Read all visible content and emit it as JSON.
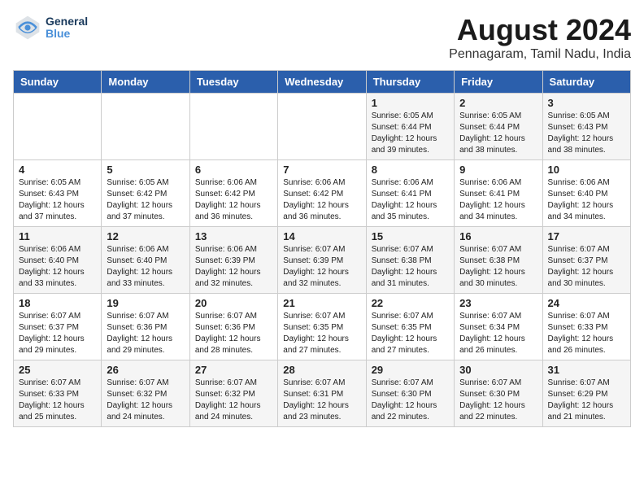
{
  "logo": {
    "line1": "General",
    "line2": "Blue"
  },
  "title": "August 2024",
  "subtitle": "Pennagaram, Tamil Nadu, India",
  "headers": [
    "Sunday",
    "Monday",
    "Tuesday",
    "Wednesday",
    "Thursday",
    "Friday",
    "Saturday"
  ],
  "weeks": [
    [
      {
        "day": "",
        "info": ""
      },
      {
        "day": "",
        "info": ""
      },
      {
        "day": "",
        "info": ""
      },
      {
        "day": "",
        "info": ""
      },
      {
        "day": "1",
        "info": "Sunrise: 6:05 AM\nSunset: 6:44 PM\nDaylight: 12 hours\nand 39 minutes."
      },
      {
        "day": "2",
        "info": "Sunrise: 6:05 AM\nSunset: 6:44 PM\nDaylight: 12 hours\nand 38 minutes."
      },
      {
        "day": "3",
        "info": "Sunrise: 6:05 AM\nSunset: 6:43 PM\nDaylight: 12 hours\nand 38 minutes."
      }
    ],
    [
      {
        "day": "4",
        "info": "Sunrise: 6:05 AM\nSunset: 6:43 PM\nDaylight: 12 hours\nand 37 minutes."
      },
      {
        "day": "5",
        "info": "Sunrise: 6:05 AM\nSunset: 6:42 PM\nDaylight: 12 hours\nand 37 minutes."
      },
      {
        "day": "6",
        "info": "Sunrise: 6:06 AM\nSunset: 6:42 PM\nDaylight: 12 hours\nand 36 minutes."
      },
      {
        "day": "7",
        "info": "Sunrise: 6:06 AM\nSunset: 6:42 PM\nDaylight: 12 hours\nand 36 minutes."
      },
      {
        "day": "8",
        "info": "Sunrise: 6:06 AM\nSunset: 6:41 PM\nDaylight: 12 hours\nand 35 minutes."
      },
      {
        "day": "9",
        "info": "Sunrise: 6:06 AM\nSunset: 6:41 PM\nDaylight: 12 hours\nand 34 minutes."
      },
      {
        "day": "10",
        "info": "Sunrise: 6:06 AM\nSunset: 6:40 PM\nDaylight: 12 hours\nand 34 minutes."
      }
    ],
    [
      {
        "day": "11",
        "info": "Sunrise: 6:06 AM\nSunset: 6:40 PM\nDaylight: 12 hours\nand 33 minutes."
      },
      {
        "day": "12",
        "info": "Sunrise: 6:06 AM\nSunset: 6:40 PM\nDaylight: 12 hours\nand 33 minutes."
      },
      {
        "day": "13",
        "info": "Sunrise: 6:06 AM\nSunset: 6:39 PM\nDaylight: 12 hours\nand 32 minutes."
      },
      {
        "day": "14",
        "info": "Sunrise: 6:07 AM\nSunset: 6:39 PM\nDaylight: 12 hours\nand 32 minutes."
      },
      {
        "day": "15",
        "info": "Sunrise: 6:07 AM\nSunset: 6:38 PM\nDaylight: 12 hours\nand 31 minutes."
      },
      {
        "day": "16",
        "info": "Sunrise: 6:07 AM\nSunset: 6:38 PM\nDaylight: 12 hours\nand 30 minutes."
      },
      {
        "day": "17",
        "info": "Sunrise: 6:07 AM\nSunset: 6:37 PM\nDaylight: 12 hours\nand 30 minutes."
      }
    ],
    [
      {
        "day": "18",
        "info": "Sunrise: 6:07 AM\nSunset: 6:37 PM\nDaylight: 12 hours\nand 29 minutes."
      },
      {
        "day": "19",
        "info": "Sunrise: 6:07 AM\nSunset: 6:36 PM\nDaylight: 12 hours\nand 29 minutes."
      },
      {
        "day": "20",
        "info": "Sunrise: 6:07 AM\nSunset: 6:36 PM\nDaylight: 12 hours\nand 28 minutes."
      },
      {
        "day": "21",
        "info": "Sunrise: 6:07 AM\nSunset: 6:35 PM\nDaylight: 12 hours\nand 27 minutes."
      },
      {
        "day": "22",
        "info": "Sunrise: 6:07 AM\nSunset: 6:35 PM\nDaylight: 12 hours\nand 27 minutes."
      },
      {
        "day": "23",
        "info": "Sunrise: 6:07 AM\nSunset: 6:34 PM\nDaylight: 12 hours\nand 26 minutes."
      },
      {
        "day": "24",
        "info": "Sunrise: 6:07 AM\nSunset: 6:33 PM\nDaylight: 12 hours\nand 26 minutes."
      }
    ],
    [
      {
        "day": "25",
        "info": "Sunrise: 6:07 AM\nSunset: 6:33 PM\nDaylight: 12 hours\nand 25 minutes."
      },
      {
        "day": "26",
        "info": "Sunrise: 6:07 AM\nSunset: 6:32 PM\nDaylight: 12 hours\nand 24 minutes."
      },
      {
        "day": "27",
        "info": "Sunrise: 6:07 AM\nSunset: 6:32 PM\nDaylight: 12 hours\nand 24 minutes."
      },
      {
        "day": "28",
        "info": "Sunrise: 6:07 AM\nSunset: 6:31 PM\nDaylight: 12 hours\nand 23 minutes."
      },
      {
        "day": "29",
        "info": "Sunrise: 6:07 AM\nSunset: 6:30 PM\nDaylight: 12 hours\nand 22 minutes."
      },
      {
        "day": "30",
        "info": "Sunrise: 6:07 AM\nSunset: 6:30 PM\nDaylight: 12 hours\nand 22 minutes."
      },
      {
        "day": "31",
        "info": "Sunrise: 6:07 AM\nSunset: 6:29 PM\nDaylight: 12 hours\nand 21 minutes."
      }
    ]
  ]
}
